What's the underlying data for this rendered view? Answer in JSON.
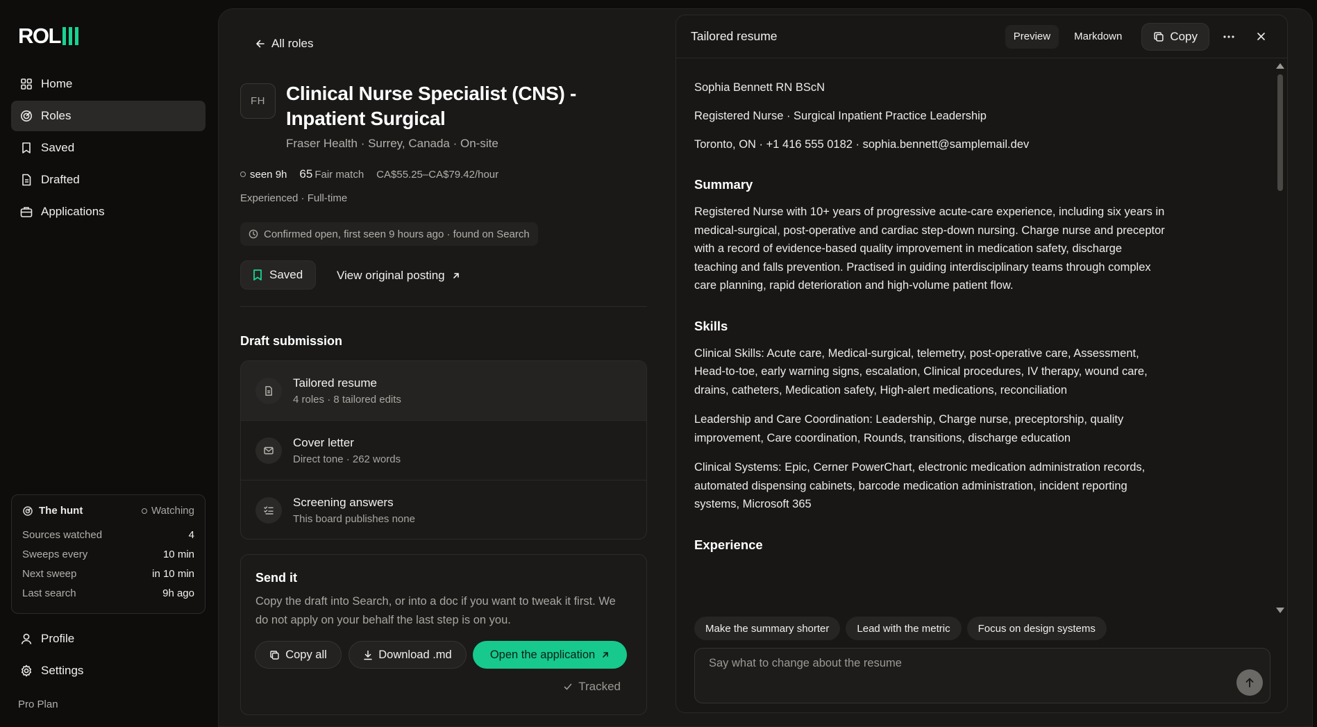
{
  "app": {
    "logo": "ROL",
    "brand_color": "#18d392"
  },
  "sidebar": {
    "items": [
      {
        "label": "Home",
        "icon": "grid-icon"
      },
      {
        "label": "Roles",
        "icon": "target-icon",
        "active": true
      },
      {
        "label": "Saved",
        "icon": "bookmark-icon"
      },
      {
        "label": "Drafted",
        "icon": "document-icon"
      },
      {
        "label": "Applications",
        "icon": "briefcase-icon"
      }
    ],
    "hunt": {
      "title": "The hunt",
      "status": "Watching",
      "rows": [
        {
          "label": "Sources watched",
          "value": "4"
        },
        {
          "label": "Sweeps every",
          "value": "10 min"
        },
        {
          "label": "Next sweep",
          "value": "in 10 min"
        },
        {
          "label": "Last search",
          "value": "9h ago"
        }
      ]
    },
    "bottom_items": [
      {
        "label": "Profile",
        "icon": "user-icon"
      },
      {
        "label": "Settings",
        "icon": "gear-icon"
      }
    ],
    "plan": "Pro Plan"
  },
  "role": {
    "back_label": "All roles",
    "company_initials": "FH",
    "title": "Clinical Nurse Specialist (CNS) - Inpatient Surgical",
    "subtitle": "Fraser Health · Surrey, Canada · On-site",
    "seen": "seen 9h",
    "match_score": "65",
    "match_label": "Fair match",
    "salary": "CA$55.25–CA$79.42/hour",
    "tags": "Experienced · Full-time",
    "confirmation": "Confirmed open, first seen 9 hours ago · found on Search",
    "saved_label": "Saved",
    "view_posting_label": "View original posting"
  },
  "draft": {
    "section_title": "Draft submission",
    "items": [
      {
        "name": "Tailored resume",
        "desc": "4 roles · 8 tailored edits",
        "icon": "document-icon",
        "active": true
      },
      {
        "name": "Cover letter",
        "desc": "Direct tone · 262 words",
        "icon": "mail-icon"
      },
      {
        "name": "Screening answers",
        "desc": "This board publishes none",
        "icon": "checklist-icon"
      }
    ]
  },
  "send": {
    "title": "Send it",
    "description": "Copy the draft into Search, or into a doc if you want to tweak it first. We do not apply on your behalf the last step is on you.",
    "copy_all": "Copy all",
    "download": "Download .md",
    "open_application": "Open the application",
    "tracked": "Tracked"
  },
  "resume_panel": {
    "title": "Tailored resume",
    "tabs": [
      "Preview",
      "Markdown"
    ],
    "copy_label": "Copy",
    "content": {
      "name": "Sophia Bennett RN BScN",
      "headline": "Registered Nurse · Surgical Inpatient Practice Leadership",
      "contact": "Toronto, ON · +1 416 555 0182 · sophia.bennett@samplemail.dev",
      "summary_heading": "Summary",
      "summary": "Registered Nurse with 10+ years of progressive acute-care experience, including six years in medical-surgical, post-operative and cardiac step-down nursing. Charge nurse and preceptor with a record of evidence-based quality improvement in medication safety, discharge teaching and falls prevention. Practised in guiding interdisciplinary teams through complex care planning, rapid deterioration and high-volume patient flow.",
      "skills_heading": "Skills",
      "skills": [
        "Clinical Skills: Acute care, Medical-surgical, telemetry, post-operative care, Assessment, Head-to-toe, early warning signs, escalation, Clinical procedures, IV therapy, wound care, drains, catheters, Medication safety, High-alert medications, reconciliation",
        "Leadership and Care Coordination: Leadership, Charge nurse, preceptorship, quality improvement, Care coordination, Rounds, transitions, discharge education",
        "Clinical Systems: Epic, Cerner PowerChart, electronic medication administration records, automated dispensing cabinets, barcode medication administration, incident reporting systems, Microsoft 365"
      ],
      "experience_heading": "Experience"
    },
    "suggestions": [
      "Make the summary shorter",
      "Lead with the metric",
      "Focus on design systems"
    ],
    "prompt_placeholder": "Say what to change about the resume"
  }
}
